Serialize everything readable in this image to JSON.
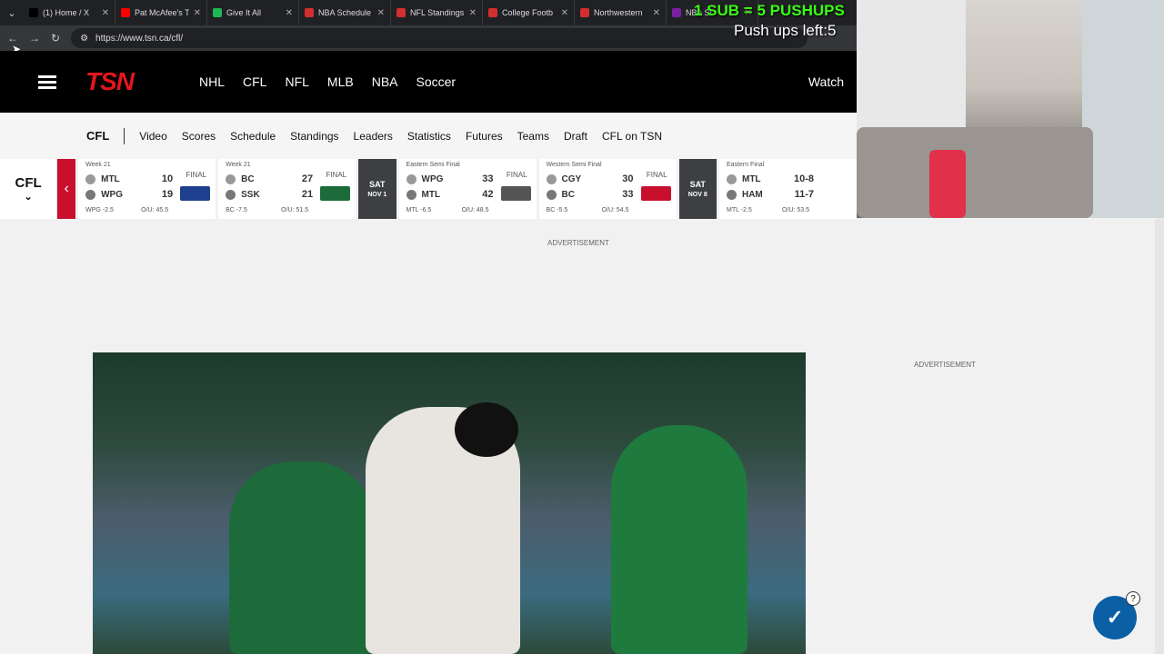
{
  "browser": {
    "tabs": [
      {
        "title": "(1) Home / X",
        "color": "#000000"
      },
      {
        "title": "Pat McAfee's T",
        "color": "#ff0000"
      },
      {
        "title": "Give It All",
        "color": "#1db954"
      },
      {
        "title": "NBA Schedule",
        "color": "#d32f2f"
      },
      {
        "title": "NFL Standings",
        "color": "#d32f2f"
      },
      {
        "title": "College Footb",
        "color": "#d32f2f"
      },
      {
        "title": "Northwestern",
        "color": "#d32f2f"
      },
      {
        "title": "NBA St",
        "color": "#7b1fa2"
      }
    ],
    "url": "https://www.tsn.ca/cfl/"
  },
  "stream_overlay": {
    "line1": "1 SUB = 5 PUSHUPS",
    "line2": "Push ups left:5"
  },
  "site": {
    "logo": "TSN",
    "nav": [
      "NHL",
      "CFL",
      "NFL",
      "MLB",
      "NBA",
      "Soccer"
    ],
    "watch": "Watch",
    "subnav_title": "CFL",
    "subnav": [
      "Video",
      "Scores",
      "Schedule",
      "Standings",
      "Leaders",
      "Statistics",
      "Futures",
      "Teams",
      "Draft",
      "CFL on TSN"
    ]
  },
  "scorestrip": {
    "sport": "CFL",
    "games": [
      {
        "label": "Week 21",
        "t1": "MTL",
        "s1": "10",
        "t2": "WPG",
        "s2": "19",
        "status": "FINAL",
        "odds": "WPG -2.5",
        "ou": "O/U: 45.5",
        "logo_color": "#1f3f8f"
      },
      {
        "label": "Week 21",
        "t1": "BC",
        "s1": "27",
        "t2": "SSK",
        "s2": "21",
        "status": "FINAL",
        "odds": "BC -7.5",
        "ou": "O/U: 51.5",
        "logo_color": "#1d6b3a"
      }
    ],
    "date1": {
      "day": "SAT",
      "date": "NOV 1"
    },
    "games2": [
      {
        "label": "Eastern Semi Final",
        "t1": "WPG",
        "s1": "33",
        "t2": "MTL",
        "s2": "42",
        "status": "FINAL",
        "odds": "MTL -6.5",
        "ou": "O/U: 48.5",
        "logo_color": "#555555"
      },
      {
        "label": "Western Semi Final",
        "t1": "CGY",
        "s1": "30",
        "t2": "BC",
        "s2": "33",
        "status": "FINAL",
        "odds": "BC -5.5",
        "ou": "O/U: 54.5",
        "logo_color": "#c8102e"
      }
    ],
    "date2": {
      "day": "SAT",
      "date": "NOV 8"
    },
    "games3": [
      {
        "label": "Eastern Final",
        "t1": "MTL",
        "s1": "10-8",
        "t2": "HAM",
        "s2": "11-7",
        "status": "",
        "odds": "MTL -2.5",
        "ou": "O/U: 53.5",
        "logo_color": "#ffffff"
      }
    ]
  },
  "ads": {
    "label": "ADVERTISEMENT"
  },
  "widgets": {
    "help": "?"
  }
}
